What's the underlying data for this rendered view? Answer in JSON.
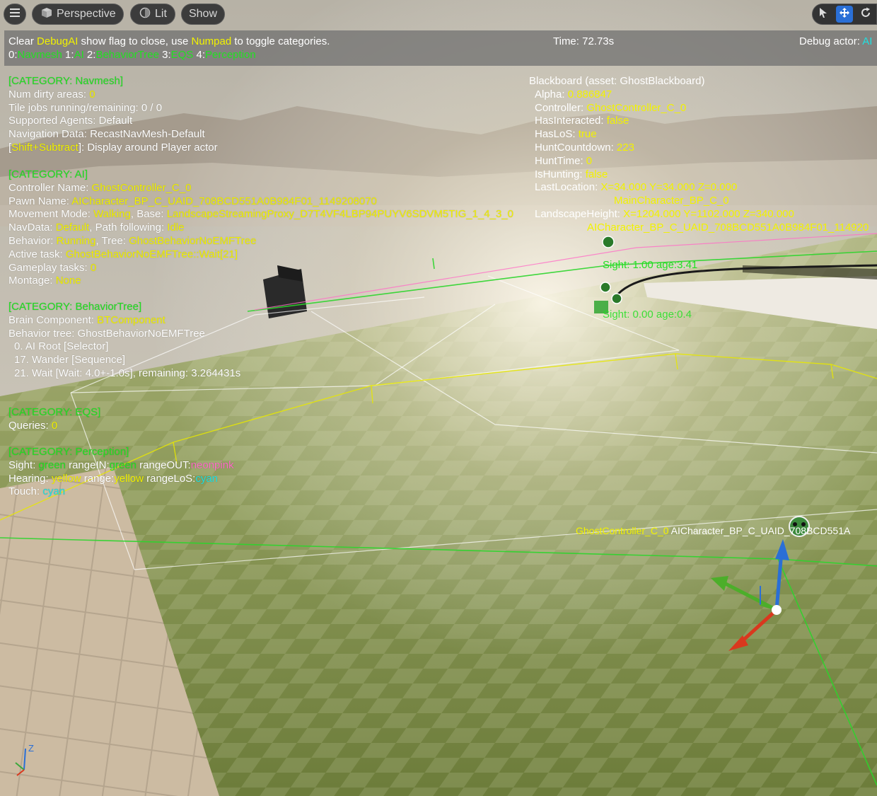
{
  "toolbar": {
    "menu_icon": "hamburger-icon",
    "perspective_label": "Perspective",
    "lit_label": "Lit",
    "show_label": "Show",
    "tools": [
      "select-arrow-icon",
      "move-icon",
      "rotate-icon"
    ]
  },
  "debug_header": {
    "clear": "Clear ",
    "debugai": "DebugAI",
    "show_flag": " show flag to close, use ",
    "numpad": "Numpad",
    "toggle": " to toggle categories.",
    "categories": [
      {
        "key": "0:",
        "name": "Navmesh"
      },
      {
        "key": "1:",
        "name": "AI"
      },
      {
        "key": "2:",
        "name": "BehaviorTree"
      },
      {
        "key": "3:",
        "name": "EQS"
      },
      {
        "key": "4:",
        "name": "Perception"
      }
    ],
    "time": "Time: 72.73s",
    "debug_actor_label": "Debug actor: ",
    "debug_actor_value": "AI"
  },
  "navmesh": {
    "header": "[CATEGORY: Navmesh]",
    "dirty_label": "Num dirty areas: ",
    "dirty_value": "0",
    "tile_jobs": "Tile jobs running/remaining: 0 / 0",
    "agents_label": "Supported Agents: ",
    "agents_value": "Default",
    "navdata_label": "Navigation Data: ",
    "navdata_value": "RecastNavMesh-Default",
    "shift_bracket_open": "[",
    "shift_key": "Shift+Subtract",
    "shift_rest": "]: Display around Player actor"
  },
  "ai": {
    "header": "[CATEGORY: AI]",
    "controller_label": "Controller Name: ",
    "controller_value": "GhostController_C_0",
    "pawn_label": "Pawn Name: ",
    "pawn_value": "AICharacter_BP_C_UAID_708BCD551A0B984F01_1149208070",
    "movement_label": "Movement Mode: ",
    "movement_value": "Walking",
    "base_label": ", Base: ",
    "base_value": "LandscapeStreamingProxy_D7T4VF4LBP94PUYV6SDVM5TIG_1_4_3_0",
    "navdata_label": "NavData: ",
    "navdata_value": "Default",
    "path_label": ", Path following: ",
    "path_value": "Idle",
    "behavior_label": "Behavior: ",
    "behavior_value": "Running",
    "tree_label": ", Tree: ",
    "tree_value": "GhostBehaviorNoEMFTree",
    "task_label": "Active task: ",
    "task_value": "GhostBehaviorNoEMFTree::Wait[21]",
    "gameplay_label": "Gameplay tasks: ",
    "gameplay_value": "0",
    "montage_label": "Montage: ",
    "montage_value": "None"
  },
  "bt": {
    "header": "[CATEGORY: BehaviorTree]",
    "brain_label": "Brain Component: ",
    "brain_value": "BTComponent",
    "tree_line": "Behavior tree: GhostBehaviorNoEMFTree",
    "nodes": [
      "0. AI Root [Selector]",
      "17. Wander [Sequence]",
      "21. Wait [Wait: 4.0+-1.0s], remaining: 3.264431s"
    ]
  },
  "eqs": {
    "header": "[CATEGORY: EQS]",
    "queries_label": "Queries: ",
    "queries_value": "0"
  },
  "perception": {
    "header": "[CATEGORY: Perception]",
    "sight_label": "Sight: ",
    "sight_value": "green",
    "rangein_label": " rangeIN:",
    "rangein_value": "green",
    "rangeout_label": " rangeOUT:",
    "rangeout_value": "neonpink",
    "hearing_label": "Hearing: ",
    "hearing_value": "yellow",
    "range_label": " range:",
    "range_value": "yellow",
    "rangelos_label": " rangeLoS:",
    "rangelos_value": "cyan",
    "touch_label": "Touch: ",
    "touch_value": "cyan"
  },
  "blackboard": {
    "header": "Blackboard (asset: GhostBlackboard)",
    "rows": [
      {
        "key": "Alpha: ",
        "value": "0.886847"
      },
      {
        "key": "Controller: ",
        "value": "GhostController_C_0"
      },
      {
        "key": "HasInteracted: ",
        "value": "false"
      },
      {
        "key": "HasLoS: ",
        "value": "true"
      },
      {
        "key": "HuntCountdown: ",
        "value": "223"
      },
      {
        "key": "HuntTime: ",
        "value": "0"
      },
      {
        "key": "IsHunting: ",
        "value": "false"
      },
      {
        "key": "LastLocation: ",
        "value": "X=34.000 Y=34.000 Z=0.000"
      },
      {
        "key": "",
        "value": "MainCharacter_BP_C_0"
      },
      {
        "key": "LandscapeHeight: ",
        "value": "X=1204.000 Y=1102.000 Z=340.000"
      },
      {
        "key": "",
        "value": "AICharacter_BP_C_UAID_708BCD551A0B984F01_114920"
      }
    ]
  },
  "scene_labels": {
    "sight1": "Sight: 1.00 age:3.41",
    "sight2": "Sight: 0.00 age:0.4",
    "controller_tag": "GhostController_C_0",
    "character_tag": " AICharacter_BP_C_UAID_708BCD551A",
    "axis_z": "Z"
  },
  "colors": {
    "green": "#22e022",
    "yellow": "#f2f200",
    "cyan": "#20e0e0",
    "pink": "#ff6ec7",
    "selected_tool": "#2a6fd6"
  }
}
